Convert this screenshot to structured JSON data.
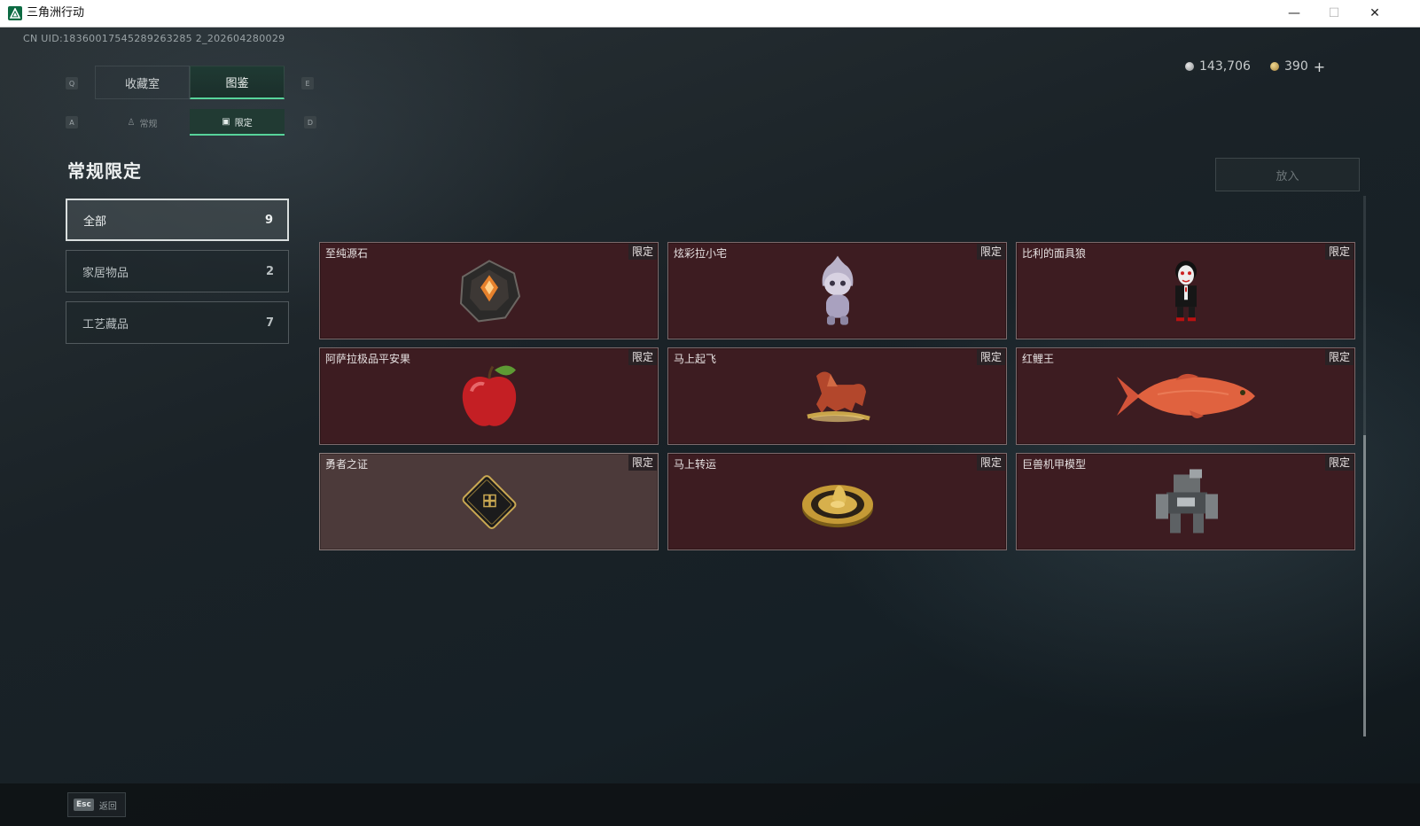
{
  "window": {
    "title": "三角洲行动",
    "minimize_glyph": "—",
    "maximize_glyph": "☐",
    "close_glyph": "✕"
  },
  "header": {
    "uid": "CN UID:18360017545289263285 2_202604280029",
    "currency": [
      {
        "icon": "silver-coin-icon",
        "value": "143,706"
      },
      {
        "icon": "gold-coin-icon",
        "value": "390"
      }
    ],
    "add_glyph": "+"
  },
  "tabs": {
    "prev_key": "Q",
    "next_key": "E",
    "items": [
      {
        "label": "收藏室",
        "active": false
      },
      {
        "label": "图鉴",
        "active": true
      }
    ]
  },
  "subtabs": {
    "prev_key": "A",
    "next_key": "D",
    "items": [
      {
        "label": "常规",
        "icon": "figure-icon",
        "active": false
      },
      {
        "label": "限定",
        "icon": "frame-icon",
        "active": true
      }
    ]
  },
  "sidebar": {
    "title": "常规限定",
    "categories": [
      {
        "label": "全部",
        "count": "9",
        "active": true
      },
      {
        "label": "家居物品",
        "count": "2",
        "active": false
      },
      {
        "label": "工艺藏品",
        "count": "7",
        "active": false
      }
    ]
  },
  "actions": {
    "put_label": "放入"
  },
  "items": [
    {
      "name": "至纯源石",
      "badge": "限定",
      "icon": "crystal-icon"
    },
    {
      "name": "炫彩拉小宅",
      "badge": "限定",
      "icon": "figurine-icon"
    },
    {
      "name": "比利的面具狼",
      "badge": "限定",
      "icon": "puppet-icon"
    },
    {
      "name": "阿萨拉极品平安果",
      "badge": "限定",
      "icon": "apple-icon"
    },
    {
      "name": "马上起飞",
      "badge": "限定",
      "icon": "horse-icon"
    },
    {
      "name": "红鲤王",
      "badge": "限定",
      "icon": "carp-icon"
    },
    {
      "name": "勇者之证",
      "badge": "限定",
      "icon": "card-icon"
    },
    {
      "name": "马上转运",
      "badge": "限定",
      "icon": "golden-wheel-icon"
    },
    {
      "name": "巨兽机甲模型",
      "badge": "限定",
      "icon": "mech-icon"
    }
  ],
  "footer": {
    "esc_key": "Esc",
    "back_label": "返回"
  }
}
